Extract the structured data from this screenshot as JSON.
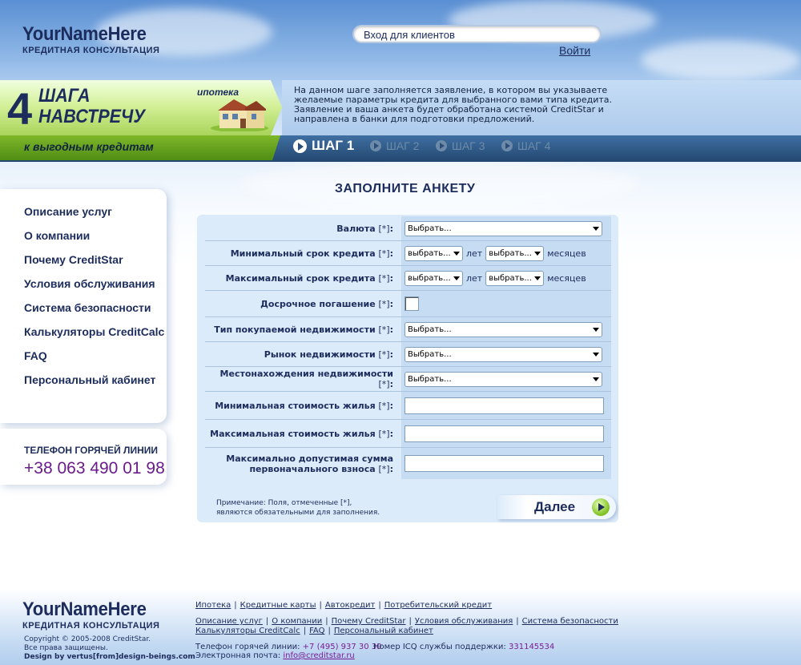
{
  "header": {
    "logo_name": "YourNameHere",
    "logo_tagline": "КРЕДИТНАЯ КОНСУЛЬТАЦИЯ",
    "login_box_text": "Вход для клиентов",
    "login_link": "Войти"
  },
  "banner": {
    "number": "4",
    "title_line1": "ШАГА",
    "title_line2": "НАВСТРЕЧУ",
    "slogan": "к выгодным кредитам",
    "product": "ипотека",
    "info": "На данном шаге заполняется заявление, в котором вы указываете желаемые параметры кредита для выбранного вами типа кредита. Заявление и ваша анкета будет обработана системой CreditStar и направлена в банки для подготовки предложений.",
    "steps": [
      {
        "label": "ШАГ 1",
        "active": true
      },
      {
        "label": "ШАГ 2",
        "active": false
      },
      {
        "label": "ШАГ 3",
        "active": false
      },
      {
        "label": "ШАГ 4",
        "active": false
      }
    ]
  },
  "sidebar": {
    "items": [
      "Описание услуг",
      "О компании",
      "Почему CreditStar",
      "Условия обслуживания",
      "Система безопасности",
      "Калькуляторы CreditCalc",
      "FAQ",
      "Персональный кабинет"
    ],
    "hotline_title": "ТЕЛЕФОН ГОРЯЧЕЙ ЛИНИИ",
    "hotline_phone": "+38 063 490 01 98"
  },
  "form": {
    "title": "ЗАПОЛНИТЕ АНКЕТУ",
    "required_mark": "[*]",
    "select_placeholder": "Выбрать...",
    "small_select_placeholder": "выбрать...",
    "years_label": "лет",
    "months_label": "месяцев",
    "fields": {
      "currency": "Валюта",
      "min_term": "Минимальный срок кредита",
      "max_term": "Максимальный срок кредита",
      "early_repayment": "Досрочное погашение",
      "property_type": "Тип покупаемой недвижимости",
      "property_market": "Рынок недвижимости",
      "property_location": "Местонахождения недвижимости",
      "min_cost": "Минимальная стоимость жилья",
      "max_cost": "Максимальная стоимость жилья",
      "max_down_payment": "Максимально допустимая сумма первоначального взноса"
    },
    "note_line1": "Примечание: Поля, отмеченные [*],",
    "note_line2": "являются обязательными для заполнения.",
    "next_button": "Далее"
  },
  "footer": {
    "logo_name": "YourNameHere",
    "logo_tagline": "КРЕДИТНАЯ КОНСУЛЬТАЦИЯ",
    "copyright": "Copyright © 2005-2008 CreditStar.",
    "rights": "Все права защищены.",
    "design": "Design by vertus[from]design-beings.com",
    "links_row1": [
      "Ипотека",
      "Кредитные карты",
      "Автокредит",
      "Потребительский кредит"
    ],
    "links_row2": [
      "Описание услуг",
      "О компании",
      "Почему CreditStar",
      "Условия обслуживания",
      "Система безопасности"
    ],
    "links_row3": [
      "Калькуляторы CreditCalc",
      "FAQ",
      "Персональный кабинет"
    ],
    "hotline_label": "Телефон горячей линии:",
    "hotline_value": "+7 (495) 937 30 30",
    "icq_label": "Номер ICQ службы поддержки:",
    "icq_value": "331145534",
    "email_label": "Электронная почта:",
    "email_value": "info@creditstar.ru"
  },
  "colors": {
    "primary_text": "#1c2c5c",
    "accent_green": "#7fb72b",
    "phone_purple": "#6b1b8c"
  }
}
